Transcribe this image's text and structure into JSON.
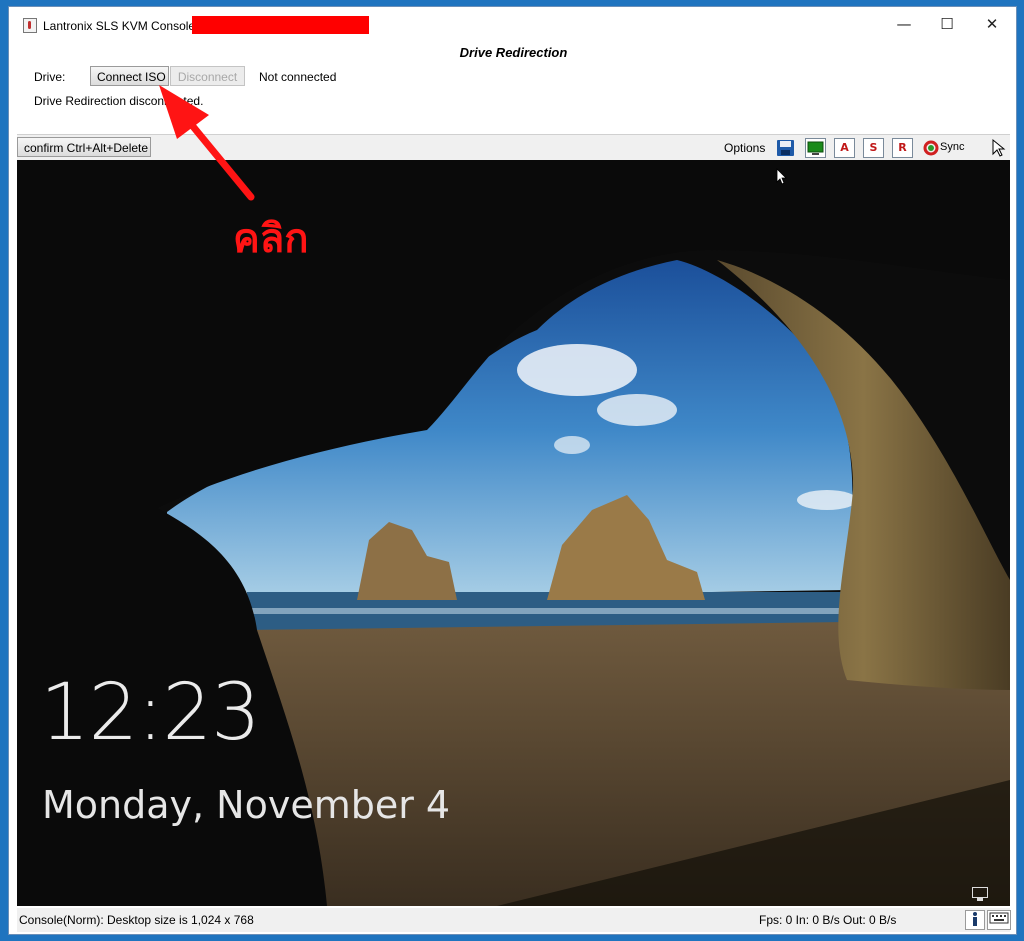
{
  "window": {
    "title": "Lantronix SLS KVM Console -",
    "minimize": "—",
    "maximize": "☐",
    "close": "✕"
  },
  "drive_panel": {
    "title": "Drive Redirection",
    "drive_label": "Drive:",
    "connect_button": "Connect ISO",
    "disconnect_button": "Disconnect",
    "connection_status": "Not connected",
    "status_message": "Drive Redirection disconnected."
  },
  "toolbar": {
    "cad_button": "confirm Ctrl+Alt+Delete",
    "options_label": "Options",
    "icons": [
      {
        "name": "save-icon",
        "glyph": "💾"
      },
      {
        "name": "monitor-icon",
        "glyph": ""
      },
      {
        "name": "a-icon",
        "glyph": "A"
      },
      {
        "name": "s-icon",
        "glyph": "S"
      },
      {
        "name": "r-icon",
        "glyph": "R"
      }
    ],
    "sync_label": "Sync"
  },
  "lockscreen": {
    "time": "12:23",
    "date": "Monday, November 4"
  },
  "annotation": {
    "label": "คลิก",
    "color": "#ff1414"
  },
  "statusbar": {
    "left": "Console(Norm): Desktop size is 1,024 x 768",
    "right": "Fps: 0 In: 0 B/s Out: 0 B/s"
  }
}
